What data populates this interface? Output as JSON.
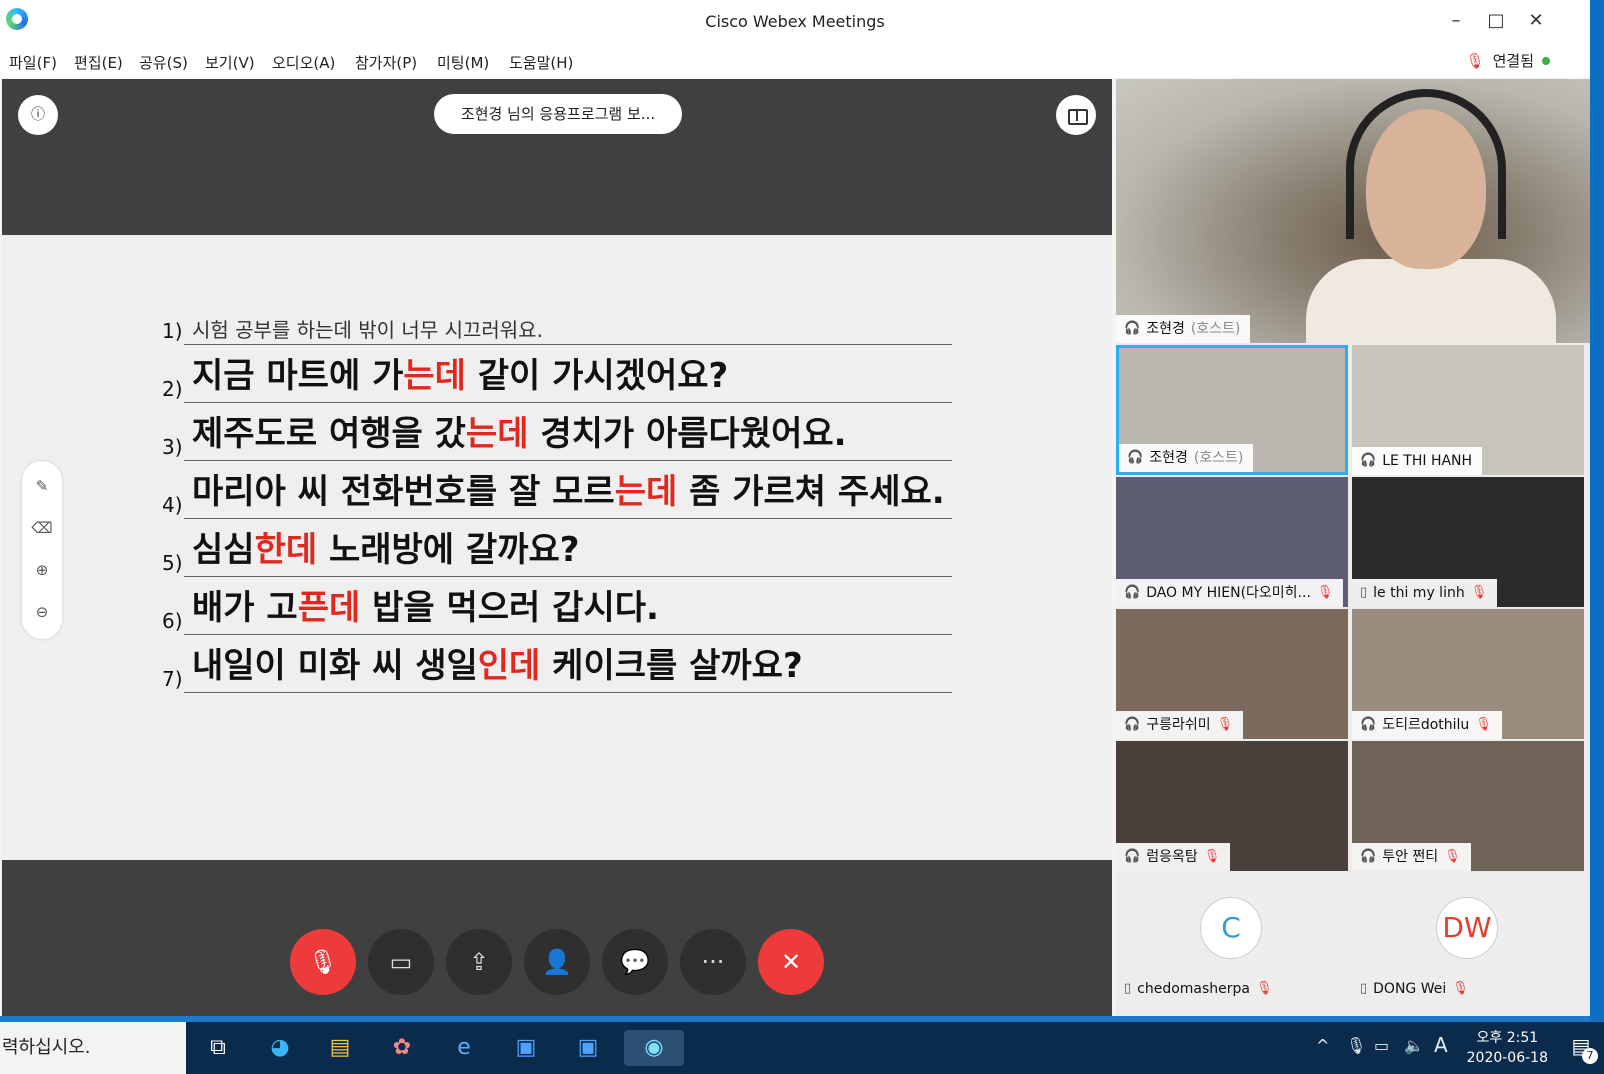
{
  "window": {
    "title": "Cisco Webex Meetings",
    "minimize_glyph": "–",
    "maximize_glyph": "□",
    "close_glyph": "✕"
  },
  "menu": {
    "items": [
      "파일(F)",
      "편집(E)",
      "공유(S)",
      "보기(V)",
      "오디오(A)",
      "참가자(P)",
      "미팅(M)",
      "도움말(H)"
    ],
    "connection_status": "연결됨"
  },
  "share": {
    "title": "조현경 님의 응용프로그램 보..."
  },
  "slide": {
    "rows": [
      {
        "num": "1)",
        "handwritten": "시험 공부를 하는데 밖이 너무 시끄러워요."
      },
      {
        "num": "2)",
        "before": "지금 마트에 가",
        "red": "는데",
        "after": " 같이 가시겠어요?"
      },
      {
        "num": "3)",
        "before": "제주도로 여행을 갔",
        "red": "는데",
        "after": " 경치가 아름다웠어요."
      },
      {
        "num": "4)",
        "before": "마리아 씨 전화번호를 잘 모르",
        "red": "는데",
        "after": " 좀 가르쳐 주세요."
      },
      {
        "num": "5)",
        "before": "심심",
        "red": "한데",
        "after": " 노래방에 갈까요?"
      },
      {
        "num": "6)",
        "before": "배가 고",
        "red": "픈데",
        "after": " 밥을 먹으러 갑시다."
      },
      {
        "num": "7)",
        "before": "내일이 미화 씨 생일",
        "red": "인데",
        "after": " 케이크를 살까요?"
      }
    ]
  },
  "controls": {
    "more_glyph": "···"
  },
  "participants": {
    "main": {
      "name": "조현경",
      "role": "(호스트)"
    },
    "tiles": [
      {
        "name": "조현경",
        "role": "(호스트)"
      },
      {
        "name": "LE THI HANH",
        "role": ""
      },
      {
        "name": "DAO MY HIEN(다오미히...",
        "role": ""
      },
      {
        "name": "le thi my linh",
        "role": ""
      },
      {
        "name": "구릉라쉬미",
        "role": ""
      },
      {
        "name": "도티르dothilu",
        "role": ""
      },
      {
        "name": "럼응옥탐",
        "role": ""
      },
      {
        "name": "투안 쩐티",
        "role": ""
      },
      {
        "name": "chedomasherpa",
        "role": "",
        "initials": "C"
      },
      {
        "name": "DONG  Wei",
        "role": "",
        "initials": "DW"
      }
    ]
  },
  "taskbar": {
    "search_text": "력하십시오.",
    "ime": "A",
    "time": "오후 2:51",
    "date": "2020-06-18",
    "notification_count": "7"
  },
  "colors": {
    "accent_red": "#e0281e",
    "active_border": "#2ab0f0",
    "connected_dot": "#3cb043"
  }
}
